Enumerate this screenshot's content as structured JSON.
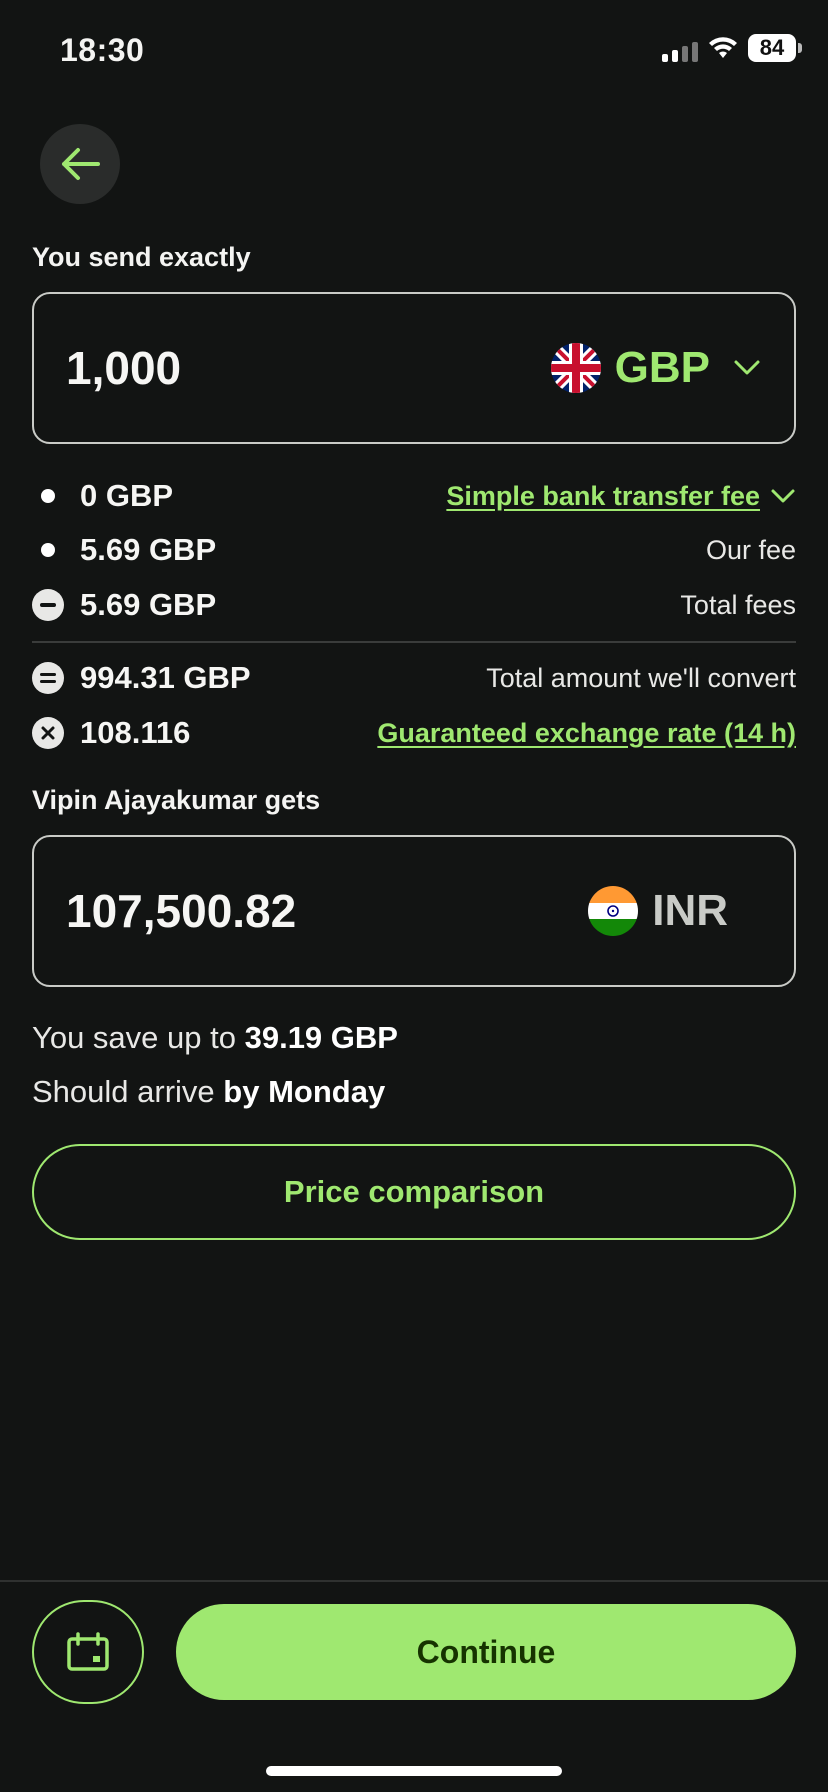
{
  "status_bar": {
    "time": "18:30",
    "battery": "84"
  },
  "send": {
    "label": "You send exactly",
    "amount": "1,000",
    "currency": "GBP"
  },
  "fees": {
    "rows": [
      {
        "amount": "0 GBP",
        "desc": "Simple bank transfer fee"
      },
      {
        "amount": "5.69 GBP",
        "desc": "Our fee"
      },
      {
        "amount": "5.69 GBP",
        "desc": "Total fees"
      },
      {
        "amount": "994.31 GBP",
        "desc": "Total amount we'll convert"
      },
      {
        "amount": "108.116",
        "desc": "Guaranteed exchange rate (14 h)"
      }
    ]
  },
  "receive": {
    "label": "Vipin Ajayakumar gets",
    "amount": "107,500.82",
    "currency": "INR"
  },
  "savings": {
    "prefix": "You save up to",
    "value": "39.19 GBP",
    "arrive_prefix": "Should arrive",
    "arrive_value": "by Monday"
  },
  "buttons": {
    "compare": "Price comparison",
    "continue": "Continue"
  },
  "colors": {
    "accent": "#9fe870",
    "background": "#121413",
    "continue_text": "#163300"
  },
  "icons": [
    "back-arrow-icon",
    "uk-flag-icon",
    "chevron-down-icon",
    "india-flag-icon",
    "calendar-icon",
    "wifi-icon",
    "signal-icon",
    "battery-icon"
  ]
}
